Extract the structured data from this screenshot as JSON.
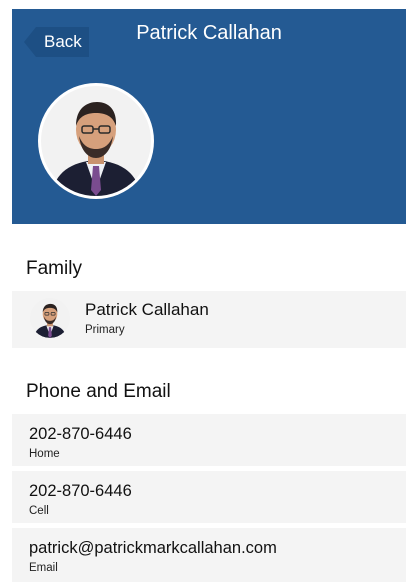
{
  "header": {
    "back_label": "Back",
    "title": "Patrick Callahan",
    "background_color": "#245a93"
  },
  "profile": {
    "avatar_icon": "person-photo-avatar"
  },
  "family": {
    "section_title": "Family",
    "members": [
      {
        "name": "Patrick Callahan",
        "role": "Primary"
      }
    ]
  },
  "contact": {
    "section_title": "Phone and Email",
    "items": [
      {
        "value": "202-870-6446",
        "label": "Home"
      },
      {
        "value": "202-870-6446",
        "label": "Cell"
      },
      {
        "value": "patrick@patrickmarkcallahan.com",
        "label": "Email"
      }
    ]
  }
}
